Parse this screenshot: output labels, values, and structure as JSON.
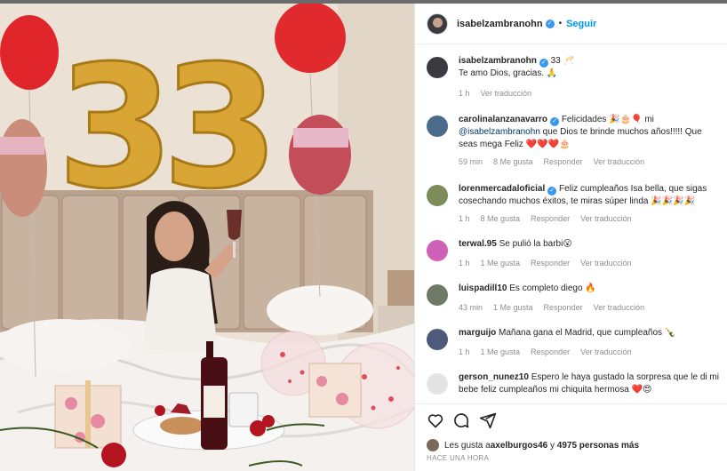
{
  "post": {
    "username": "isabelzambranohn",
    "separator": "•",
    "follow_label": "Seguir"
  },
  "caption": {
    "username": "isabelzambranohn",
    "text_line1": "33 🥂",
    "text_line2": "Te amo Dios, gracias. 🙏",
    "time": "1 h",
    "translate": "Ver traducción"
  },
  "comments": [
    {
      "username": "carolinalanzanavarro",
      "verified": true,
      "text": "Felicidades 🎉🎂🎈 mi",
      "mention": "@isabelzambranohn",
      "text_after": " que Dios te brinde muchos años!!!!! Que seas mega Feliz ❤️❤️❤️🎂",
      "time": "59 min",
      "likes": "8 Me gusta",
      "reply": "Responder",
      "translate": "Ver traducción",
      "avatar_color": "#4b6b8a"
    },
    {
      "username": "lorenmercadaloficial",
      "verified": true,
      "text": "Feliz cumpleaños Isa bella, que sigas cosechando muchos éxitos, te miras súper linda 🎉🎉🎉🎉",
      "time": "1 h",
      "likes": "8 Me gusta",
      "reply": "Responder",
      "translate": "Ver traducción",
      "avatar_color": "#7d8c5a"
    },
    {
      "username": "terwal.95",
      "verified": false,
      "text": "Se pulió la barbi😮",
      "time": "1 h",
      "likes": "1 Me gusta",
      "reply": "Responder",
      "translate": "Ver traducción",
      "avatar_color": "#d061b8"
    },
    {
      "username": "luispadill10",
      "verified": false,
      "text": "Es completo diego 🔥",
      "time": "43 min",
      "likes": "1 Me gusta",
      "reply": "Responder",
      "translate": "Ver traducción",
      "avatar_color": "#6f7a68"
    },
    {
      "username": "marguijo",
      "verified": false,
      "text": "Mañana gana el Madrid, que cumpleaños 🍾",
      "time": "1 h",
      "likes": "1 Me gusta",
      "reply": "Responder",
      "translate": "Ver traducción",
      "avatar_color": "#4e5a7a"
    },
    {
      "username": "gerson_nunez10",
      "verified": false,
      "text": "Espero le haya gustado la sorpresa que le di mi bebe feliz cumpleaños mi chiquita hermosa ❤️😍",
      "avatar_color": "#e3e3e3"
    }
  ],
  "likes_line": {
    "prefix": "Les gusta a ",
    "user": "axelburgos46",
    "suffix": " y ",
    "count": "4975 personas más"
  },
  "timestamp": "HACE UNA HORA",
  "photo": {
    "balloon_numbers": "33",
    "colors": {
      "gold": "#d9a635",
      "red": "#e0262b",
      "wall": "#ece2d6",
      "headboard": "#b8a08a"
    }
  },
  "icons": {
    "like": "heart-icon",
    "comment": "comment-icon",
    "share": "share-icon"
  }
}
